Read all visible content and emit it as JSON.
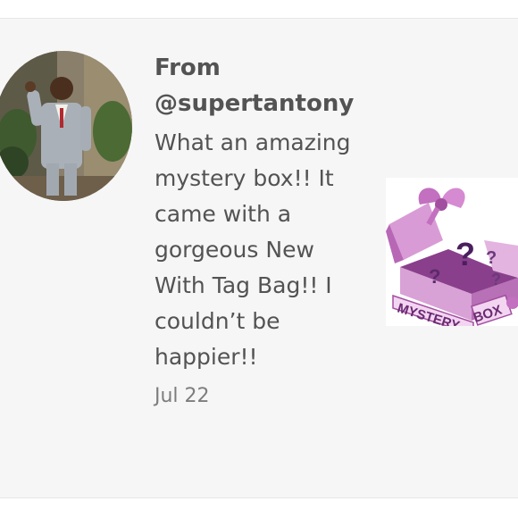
{
  "review": {
    "from_label": "From",
    "handle": "@supertantony",
    "message": "What an amazing mystery box!! It came with a gorgeous New With Tag Bag!! I couldn’t be happier!!",
    "date": "Jul 22"
  },
  "product": {
    "label_word_1": "MYSTERY",
    "label_word_2": "BOX",
    "question_mark": "?",
    "colors": {
      "box": "#c77bc4",
      "box_dark": "#9b4a9a",
      "ribbon": "#e9a8e3",
      "question": "#5a2a6a"
    }
  },
  "avatar": {
    "icon": "profile-photo"
  }
}
